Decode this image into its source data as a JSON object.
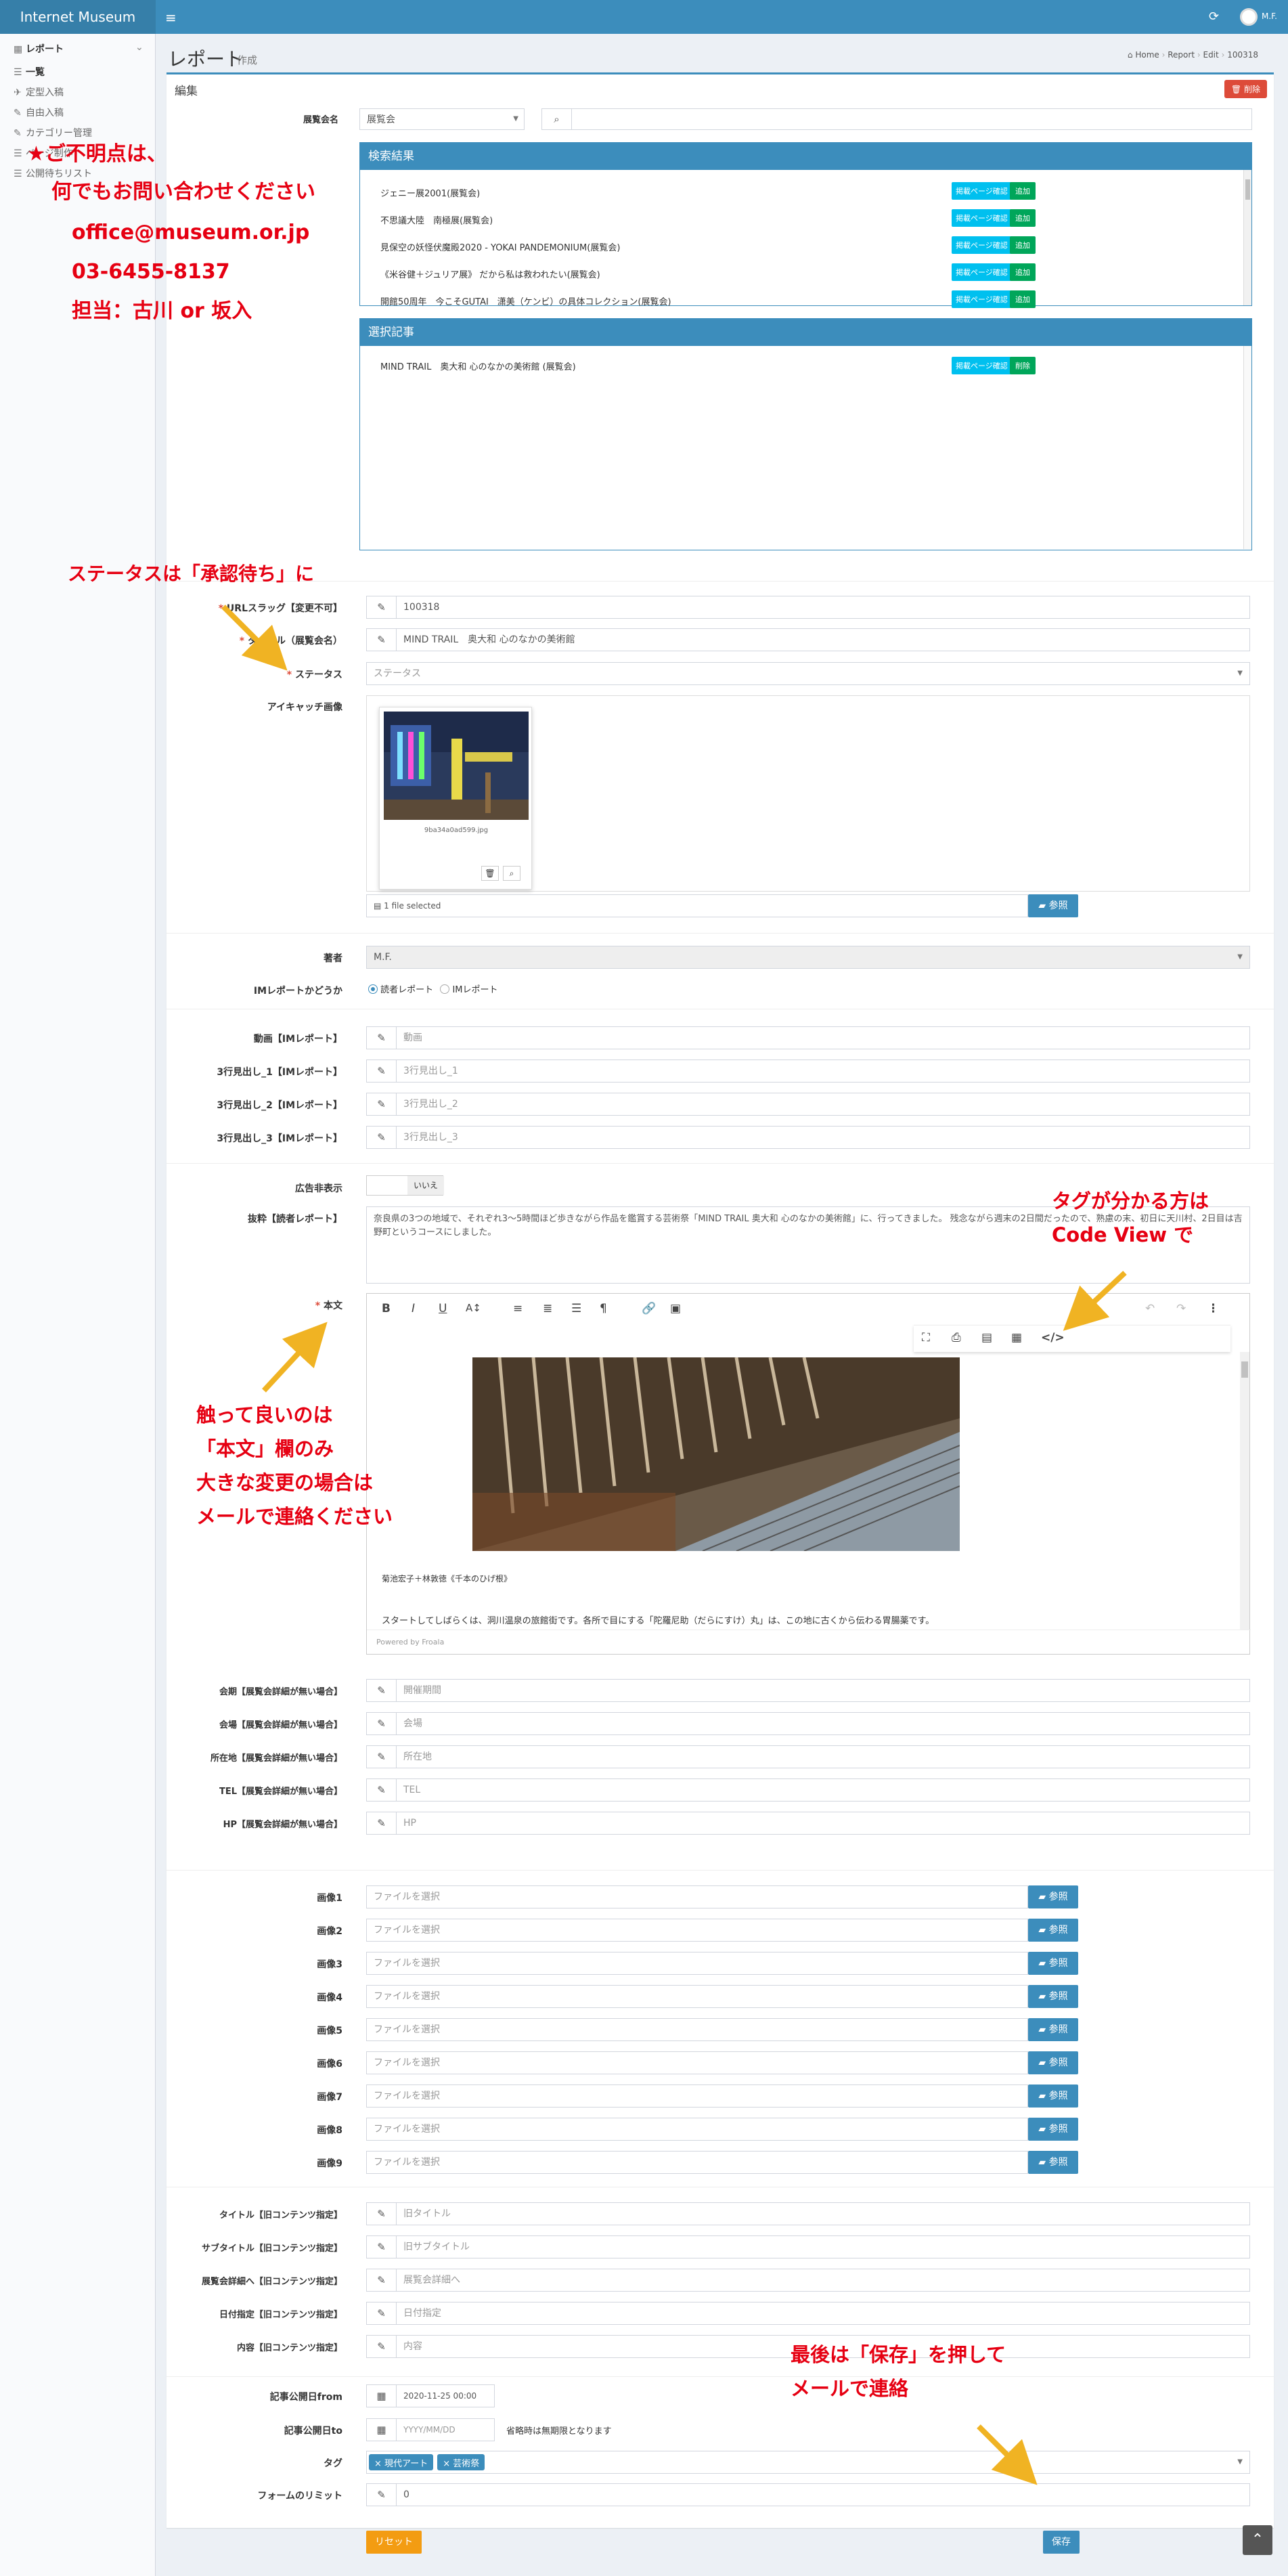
{
  "app": {
    "title": "Internet Museum",
    "menu_icon": "≡",
    "user": "M.F.",
    "refresh_icon": "⟳"
  },
  "sidebar": {
    "items": [
      {
        "label": "レポート",
        "icon": "▦"
      },
      {
        "label": "一覧",
        "icon": "☰"
      },
      {
        "label": "定型入稿",
        "icon": "✈"
      },
      {
        "label": "自由入稿",
        "icon": "✎"
      },
      {
        "label": "カテゴリー管理",
        "icon": "✎"
      },
      {
        "label": "ページ制作",
        "icon": "☰"
      },
      {
        "label": "公開待ちリスト",
        "icon": "☰"
      }
    ]
  },
  "page": {
    "title": "レポート",
    "subtitle": "作成",
    "breadcrumb": [
      "Home",
      "Report",
      "Edit",
      "100318"
    ],
    "box_title": "編集",
    "delete_label": "削除"
  },
  "exhibition": {
    "label": "展覧会名",
    "select_value": "展覧会",
    "search_placeholder": ""
  },
  "search_results": {
    "title": "検索結果",
    "confirm_label": "掲載ページ確認",
    "add_label": "追加",
    "items": [
      "ジェニー展2001(展覧会)",
      "不思議大陸　南極展(展覧会)",
      "見保空の妖怪伏魔殿2020 - YOKAI PANDEMONIUM(展覧会)",
      "《米谷健＋ジュリア展》 だから私は救われたい(展覧会)",
      "開館50周年　今こそGUTAI　潇美（ケンビ）の具体コレクション(展覧会)"
    ]
  },
  "selected": {
    "title": "選択記事",
    "confirm_label": "掲載ページ確認",
    "remove_label": "削除",
    "item": "MIND TRAIL　奥大和 心のなかの美術館 (展覧会)"
  },
  "form": {
    "slug": {
      "label": "URLスラッグ【変更不可】",
      "value": "100318"
    },
    "title": {
      "label": "タイトル（展覧会名）",
      "value": "MIND TRAIL　奥大和 心のなかの美術館"
    },
    "status": {
      "label": "ステータス",
      "placeholder": "ステータス"
    },
    "eyecatch": {
      "label": "アイキャッチ画像",
      "filename": "9ba34a0ad599.jpg",
      "selected_text": "1 file selected",
      "browse_label": "参照"
    },
    "author": {
      "label": "著者",
      "value": "M.F."
    },
    "report_type": {
      "label": "IMレポートかどうか",
      "option1": "読者レポート",
      "option2": "IMレポート"
    },
    "video": {
      "label": "動画【IMレポート】",
      "placeholder": "動画"
    },
    "h1": {
      "label": "3行見出し_1【IMレポート】",
      "placeholder": "3行見出し_1"
    },
    "h2": {
      "label": "3行見出し_2【IMレポート】",
      "placeholder": "3行見出し_2"
    },
    "h3": {
      "label": "3行見出し_3【IMレポート】",
      "placeholder": "3行見出し_3"
    },
    "ad": {
      "label": "広告非表示",
      "value": "いいえ"
    },
    "excerpt": {
      "label": "抜粋【読者レポート】",
      "text": "奈良県の3つの地域で、それぞれ3～5時間ほど歩きながら作品を鑑賞する芸術祭「MIND TRAIL 奥大和 心のなかの美術館」に、行ってきました。 残念ながら週末の2日間だったので、熟慮の末、初日に天川村、2日目は吉野町というコースにしました。"
    },
    "body": {
      "label": "本文",
      "caption": "菊池宏子＋林敦徳《千本のひげ根》",
      "text": "スタートしてしばらくは、洞川温泉の旅館街です。各所で目にする「陀羅尼助（だらにすけ）丸」は、この地に古くから伝わる胃腸薬です。",
      "powered": "Powered by Froala"
    },
    "period": {
      "label": "会期【展覧会詳細が無い場合】",
      "placeholder": "開催期間"
    },
    "venue": {
      "label": "会場【展覧会詳細が無い場合】",
      "placeholder": "会場"
    },
    "address": {
      "label": "所在地【展覧会詳細が無い場合】",
      "placeholder": "所在地"
    },
    "tel": {
      "label": "TEL【展覧会詳細が無い場合】",
      "placeholder": "TEL"
    },
    "hp": {
      "label": "HP【展覧会詳細が無い場合】",
      "placeholder": "HP"
    },
    "images": {
      "placeholder": "ファイルを選択",
      "browse_label": "参照",
      "labels": [
        "画像1",
        "画像2",
        "画像3",
        "画像4",
        "画像5",
        "画像6",
        "画像7",
        "画像8",
        "画像9"
      ]
    },
    "old_title": {
      "label": "タイトル【旧コンテンツ指定】",
      "placeholder": "旧タイトル"
    },
    "old_subtitle": {
      "label": "サブタイトル【旧コンテンツ指定】",
      "placeholder": "旧サブタイトル"
    },
    "old_detail": {
      "label": "展覧会詳細へ【旧コンテンツ指定】",
      "placeholder": "展覧会詳細へ"
    },
    "old_date": {
      "label": "日付指定【旧コンテンツ指定】",
      "placeholder": "日付指定"
    },
    "old_content": {
      "label": "内容【旧コンテンツ指定】",
      "placeholder": "内容"
    },
    "pub_from": {
      "label": "記事公開日from",
      "value": "2020-11-25 00:00"
    },
    "pub_to": {
      "label": "記事公開日to",
      "placeholder": "YYYY/MM/DD",
      "note": "省略時は無期限となります"
    },
    "tags": {
      "label": "タグ",
      "items": [
        "× 現代アート",
        "× 芸術祭"
      ]
    },
    "form_limit": {
      "label": "フォームのリミット",
      "value": "0"
    },
    "reset_label": "リセット",
    "save_label": "保存"
  },
  "notes": {
    "contact": [
      "★ご不明点は、",
      "何でもお問い合わせください",
      "office@museum.or.jp",
      "03-6455-8137",
      "担当：古川 or 坂入"
    ],
    "status": "ステータスは「承認待ち」に",
    "tag": [
      "タグが分かる方は",
      "Code View で"
    ],
    "body": [
      "触って良いのは",
      "「本文」欄のみ",
      "大きな変更の場合は",
      "メールで連絡ください"
    ],
    "save": [
      "最後は「保存」を押して",
      "メールで連絡"
    ]
  }
}
